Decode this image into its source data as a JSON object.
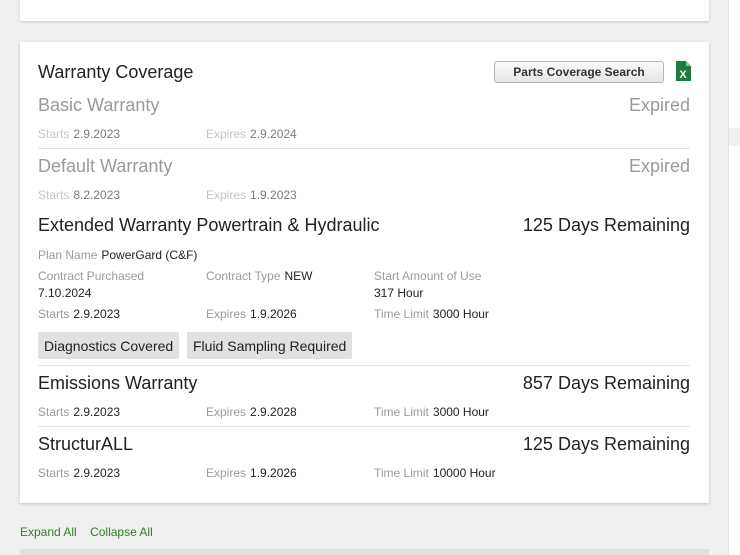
{
  "card": {
    "title": "Warranty Coverage",
    "parts_button": "Parts Coverage Search",
    "excel_icon": "excel-export-icon",
    "excel_letter": "X"
  },
  "warranties": {
    "basic": {
      "title": "Basic Warranty",
      "status": "Expired",
      "starts_label": "Starts",
      "starts": "2.9.2023",
      "expires_label": "Expires",
      "expires": "2.9.2024"
    },
    "default": {
      "title": "Default Warranty",
      "status": "Expired",
      "starts_label": "Starts",
      "starts": "8.2.2023",
      "expires_label": "Expires",
      "expires": "1.9.2023"
    },
    "extended": {
      "title": "Extended Warranty Powertrain & Hydraulic",
      "status": "125 Days Remaining",
      "plan_label": "Plan Name",
      "plan": "PowerGard (C&F)",
      "purchased_label": "Contract Purchased",
      "purchased": "7.10.2024",
      "type_label": "Contract Type",
      "type": "NEW",
      "start_use_label": "Start Amount of Use",
      "start_use": "317 Hour",
      "starts_label": "Starts",
      "starts": "2.9.2023",
      "expires_label": "Expires",
      "expires": "1.9.2026",
      "limit_label": "Time Limit",
      "limit": "3000 Hour",
      "tags": [
        "Diagnostics Covered",
        "Fluid Sampling Required"
      ]
    },
    "emissions": {
      "title": "Emissions Warranty",
      "status": "857 Days Remaining",
      "starts_label": "Starts",
      "starts": "2.9.2023",
      "expires_label": "Expires",
      "expires": "2.9.2028",
      "limit_label": "Time Limit",
      "limit": "3000 Hour"
    },
    "structurall": {
      "title": "StructurALL",
      "status": "125 Days Remaining",
      "starts_label": "Starts",
      "starts": "2.9.2023",
      "expires_label": "Expires",
      "expires": "1.9.2026",
      "limit_label": "Time Limit",
      "limit": "10000 Hour"
    }
  },
  "links": {
    "expand_all": "Expand All",
    "collapse_all": "Collapse All"
  },
  "colors": {
    "link_green": "#367c2b",
    "excel_green": "#1f7a3f"
  }
}
